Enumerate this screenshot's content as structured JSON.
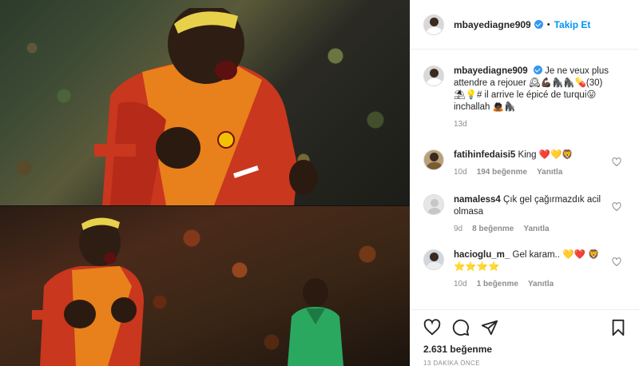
{
  "post": {
    "images": [
      "photo-celebrating-top",
      "photo-celebrating-bottom"
    ]
  },
  "header": {
    "username": "mbayediagne909",
    "separator": "•",
    "follow_label": "Takip Et"
  },
  "caption": {
    "username": "mbayediagne909",
    "text": "Je ne veux plus attendre a rejouer 🕰💪🏿🦍🦍💊(30)⛱💡# il arrive le épicé de turqui😛 inchallah 🙇🏿🦍",
    "text_part1": "Je ne veux plus attendre a rejouer",
    "text_part2": "(30)",
    "text_part3": "# il arrive le épicé de turqui",
    "text_part4": "inchallah",
    "time": "13d"
  },
  "comments": [
    {
      "username": "fatihinfedaisi5",
      "text": "King",
      "time": "10d",
      "likes": "194 beğenme",
      "reply": "Yanıtla"
    },
    {
      "username": "namaless4",
      "text": "Çık gel çağırmazdık acil olmasa",
      "time": "9d",
      "likes": "8 beğenme",
      "reply": "Yanıtla"
    },
    {
      "username": "hacioglu_m_",
      "text": "Gel karam..",
      "time": "10d",
      "likes": "1 beğenme",
      "reply": "Yanıtla"
    }
  ],
  "actions": {
    "likes": "2.631 beğenme",
    "posted": "13 DAKİKA ÖNCE"
  },
  "colors": {
    "accent": "#0095f6",
    "verified": "#3897f0",
    "muted": "#8e8e8e",
    "heart": "#e0245e",
    "yellow_heart": "#ffcc00"
  }
}
